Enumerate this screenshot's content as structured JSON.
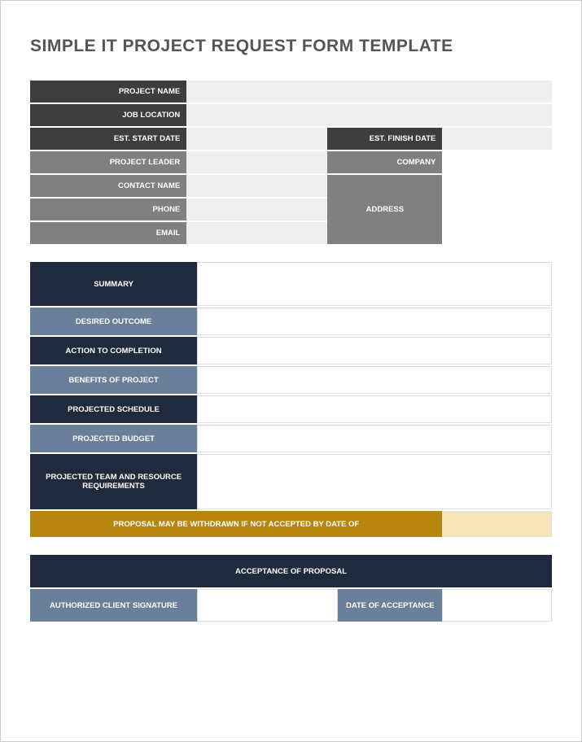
{
  "title": "SIMPLE IT PROJECT REQUEST FORM TEMPLATE",
  "info": {
    "project_name_label": "PROJECT NAME",
    "project_name": "",
    "job_location_label": "JOB LOCATION",
    "job_location": "",
    "est_start_label": "EST. START DATE",
    "est_start": "",
    "est_finish_label": "EST. FINISH DATE",
    "est_finish": "",
    "project_leader_label": "PROJECT LEADER",
    "project_leader": "",
    "company_label": "COMPANY",
    "company": "",
    "contact_name_label": "CONTACT NAME",
    "contact_name": "",
    "address_label": "ADDRESS",
    "address": "",
    "phone_label": "PHONE",
    "phone": "",
    "email_label": "EMAIL",
    "email": ""
  },
  "details": {
    "summary_label": "SUMMARY",
    "summary": "",
    "desired_outcome_label": "DESIRED OUTCOME",
    "desired_outcome": "",
    "action_label": "ACTION TO COMPLETION",
    "action": "",
    "benefits_label": "BENEFITS OF PROJECT",
    "benefits": "",
    "schedule_label": "PROJECTED SCHEDULE",
    "schedule": "",
    "budget_label": "PROJECTED BUDGET",
    "budget": "",
    "team_label": "PROJECTED TEAM AND RESOURCE REQUIREMENTS",
    "team": "",
    "withdraw_label": "PROPOSAL MAY BE WITHDRAWN IF NOT ACCEPTED BY DATE OF",
    "withdraw_date": ""
  },
  "acceptance": {
    "header": "ACCEPTANCE OF PROPOSAL",
    "signature_label": "AUTHORIZED CLIENT SIGNATURE",
    "signature": "",
    "date_label": "DATE OF ACCEPTANCE",
    "date": ""
  }
}
